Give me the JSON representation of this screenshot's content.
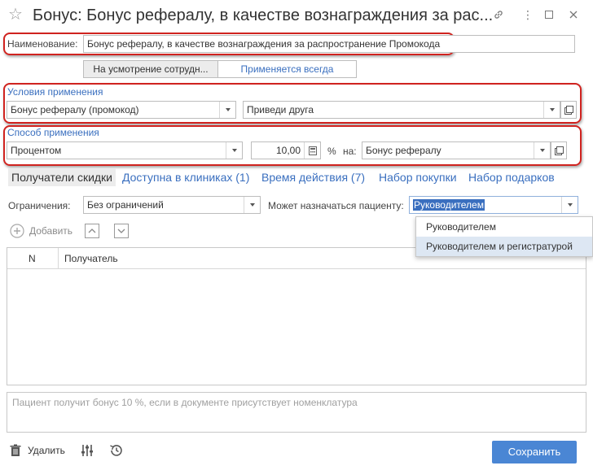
{
  "window": {
    "title": "Бонус: Бонус рефералу, в качестве вознаграждения за рас..."
  },
  "name": {
    "label": "Наименование:",
    "value": "Бонус рефералу, в качестве вознаграждения за распространение Промокода"
  },
  "mode_toggle": {
    "left_label": "На усмотрение сотрудн...",
    "right_label": "Применяется всегда"
  },
  "conditions": {
    "title": "Условия применения",
    "type_value": "Бонус рефералу (промокод)",
    "action_value": "Приведи друга"
  },
  "method": {
    "title": "Способ применения",
    "method_value": "Процентом",
    "amount_value": "10,00",
    "unit_label": "%",
    "on_label": "на:",
    "target_value": "Бонус рефералу"
  },
  "tabs": [
    {
      "label": "Получатели скидки"
    },
    {
      "label": "Доступна в клиниках (1)"
    },
    {
      "label": "Время действия (7)"
    },
    {
      "label": "Набор покупки"
    },
    {
      "label": "Набор подарков"
    }
  ],
  "recipients": {
    "restrictions_label": "Ограничения:",
    "restrictions_value": "Без ограничений",
    "assign_label": "Может назначаться пациенту:",
    "assign_value": "Руководителем",
    "add_label": "Добавить",
    "table_headers": [
      "N",
      "Получатель"
    ]
  },
  "assign_options": [
    {
      "label": "Руководителем"
    },
    {
      "label": "Руководителем и регистратурой"
    }
  ],
  "comment_placeholder": "Пациент получит бонус 10 %, если в документе присутствует номенклатура",
  "footer": {
    "delete_label": "Удалить",
    "save_label": "Сохранить"
  },
  "colors": {
    "accent": "#3a6fbf",
    "highlight_box": "#d0231f",
    "save_button": "#4a86d4"
  }
}
